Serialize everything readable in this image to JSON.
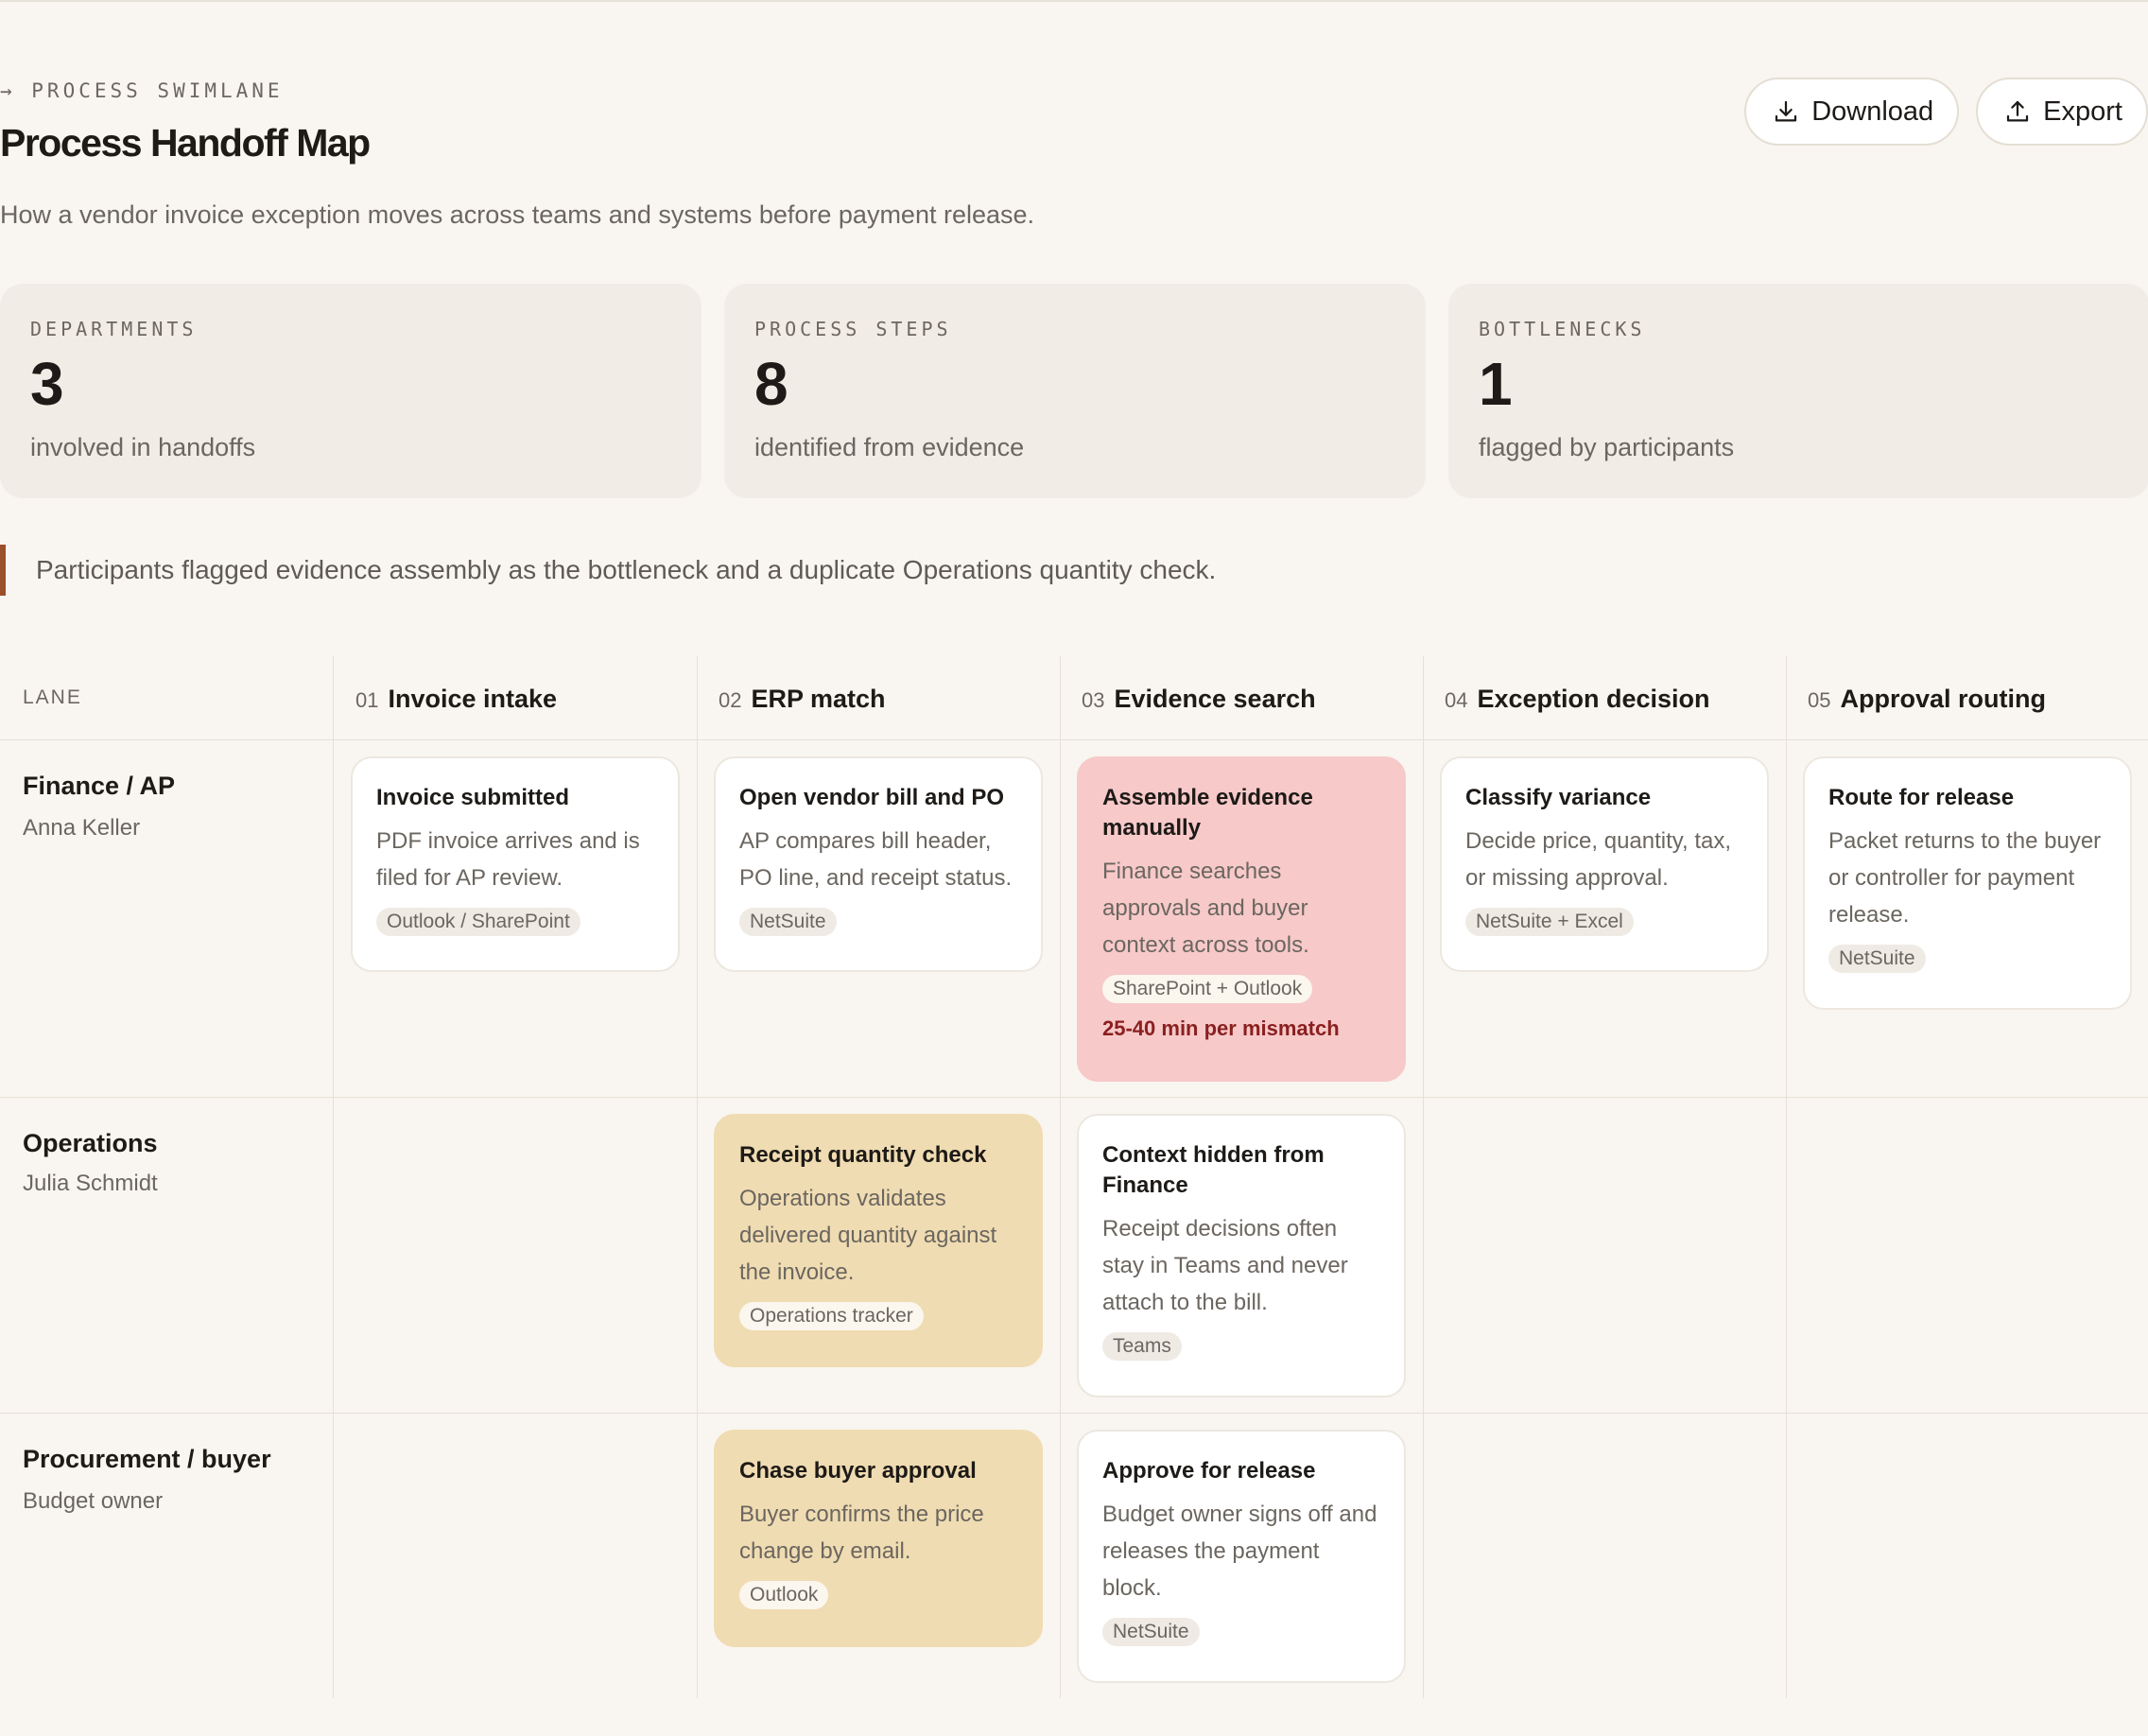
{
  "header": {
    "eyebrow": "→ PROCESS SWIMLANE",
    "title": "Process Handoff Map",
    "subtitle": "How a vendor invoice exception moves across teams and systems before payment release."
  },
  "actions": {
    "download_label": "Download",
    "download_icon": "download-icon",
    "export_label": "Export",
    "export_icon": "upload-icon"
  },
  "stats": [
    {
      "label": "DEPARTMENTS",
      "value": "3",
      "note": "involved in handoffs"
    },
    {
      "label": "PROCESS STEPS",
      "value": "8",
      "note": "identified from evidence"
    },
    {
      "label": "BOTTLENECKS",
      "value": "1",
      "note": "flagged by participants"
    }
  ],
  "callout": {
    "text": "Participants flagged evidence assembly as the bottleneck and a duplicate Operations quantity check.",
    "accent_color": "#9c4f2b"
  },
  "grid": {
    "lane_header": "LANE",
    "columns": [
      {
        "num": "01",
        "title": "Invoice intake"
      },
      {
        "num": "02",
        "title": "ERP match"
      },
      {
        "num": "03",
        "title": "Evidence search"
      },
      {
        "num": "04",
        "title": "Exception decision"
      },
      {
        "num": "05",
        "title": "Approval routing"
      }
    ],
    "lanes": [
      {
        "title": "Finance / AP",
        "owner": "Anna Keller"
      },
      {
        "title": "Operations",
        "owner": "Julia Schmidt"
      },
      {
        "title": "Procurement / buyer",
        "owner": "Budget owner"
      }
    ]
  },
  "cards": {
    "invoice_submitted": {
      "title": "Invoice submitted",
      "desc": "PDF invoice arrives and is filed for AP review.",
      "tag": "Outlook / SharePoint"
    },
    "open_vendor_bill": {
      "title": "Open vendor bill and PO",
      "desc": "AP compares bill header, PO line, and receipt status.",
      "tag": "NetSuite"
    },
    "assemble_evidence": {
      "title": "Assemble evidence manually",
      "desc": "Finance searches approvals and buyer context across tools.",
      "tag": "SharePoint + Outlook",
      "metric": "25-40 min per mismatch"
    },
    "classify_variance": {
      "title": "Classify variance",
      "desc": "Decide price, quantity, tax, or missing approval.",
      "tag": "NetSuite + Excel"
    },
    "route_for_release": {
      "title": "Route for release",
      "desc": "Packet returns to the buyer or controller for payment release.",
      "tag": "NetSuite"
    },
    "receipt_quantity_check": {
      "title": "Receipt quantity check",
      "desc": "Operations validates delivered quantity against the invoice.",
      "tag": "Operations tracker"
    },
    "context_hidden": {
      "title": "Context hidden from Finance",
      "desc": "Receipt decisions often stay in Teams and never attach to the bill.",
      "tag": "Teams"
    },
    "chase_buyer_approval": {
      "title": "Chase buyer approval",
      "desc": "Buyer confirms the price change by email.",
      "tag": "Outlook"
    },
    "approve_for_release": {
      "title": "Approve for release",
      "desc": "Budget owner signs off and releases the payment block.",
      "tag": "NetSuite"
    }
  },
  "colors": {
    "bottleneck_card": "#f7c9c9",
    "duplicate_card": "#f0dcb2",
    "metric_text": "#8a1f1f"
  }
}
